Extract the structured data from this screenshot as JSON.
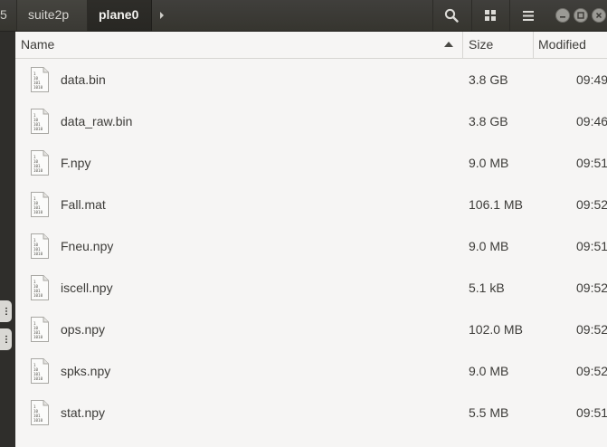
{
  "breadcrumb": {
    "prev_fragment": "5",
    "items": [
      "suite2p",
      "plane0"
    ],
    "next_icon": "chevron-right-icon"
  },
  "toolbar": {
    "search_icon": "search-icon",
    "view_icon": "grid-view-icon",
    "menu_icon": "hamburger-menu-icon"
  },
  "window_controls": [
    "minimize-icon",
    "maximize-icon",
    "close-icon"
  ],
  "columns": {
    "name": "Name",
    "size": "Size",
    "modified": "Modified"
  },
  "files": [
    {
      "name": "data.bin",
      "size": "3.8 GB",
      "modified": "09:49"
    },
    {
      "name": "data_raw.bin",
      "size": "3.8 GB",
      "modified": "09:46"
    },
    {
      "name": "F.npy",
      "size": "9.0 MB",
      "modified": "09:51"
    },
    {
      "name": "Fall.mat",
      "size": "106.1 MB",
      "modified": "09:52"
    },
    {
      "name": "Fneu.npy",
      "size": "9.0 MB",
      "modified": "09:51"
    },
    {
      "name": "iscell.npy",
      "size": "5.1 kB",
      "modified": "09:52"
    },
    {
      "name": "ops.npy",
      "size": "102.0 MB",
      "modified": "09:52"
    },
    {
      "name": "spks.npy",
      "size": "9.0 MB",
      "modified": "09:52"
    },
    {
      "name": "stat.npy",
      "size": "5.5 MB",
      "modified": "09:51"
    }
  ],
  "file_icon_text": [
    "1",
    "10",
    "101",
    "1010"
  ]
}
